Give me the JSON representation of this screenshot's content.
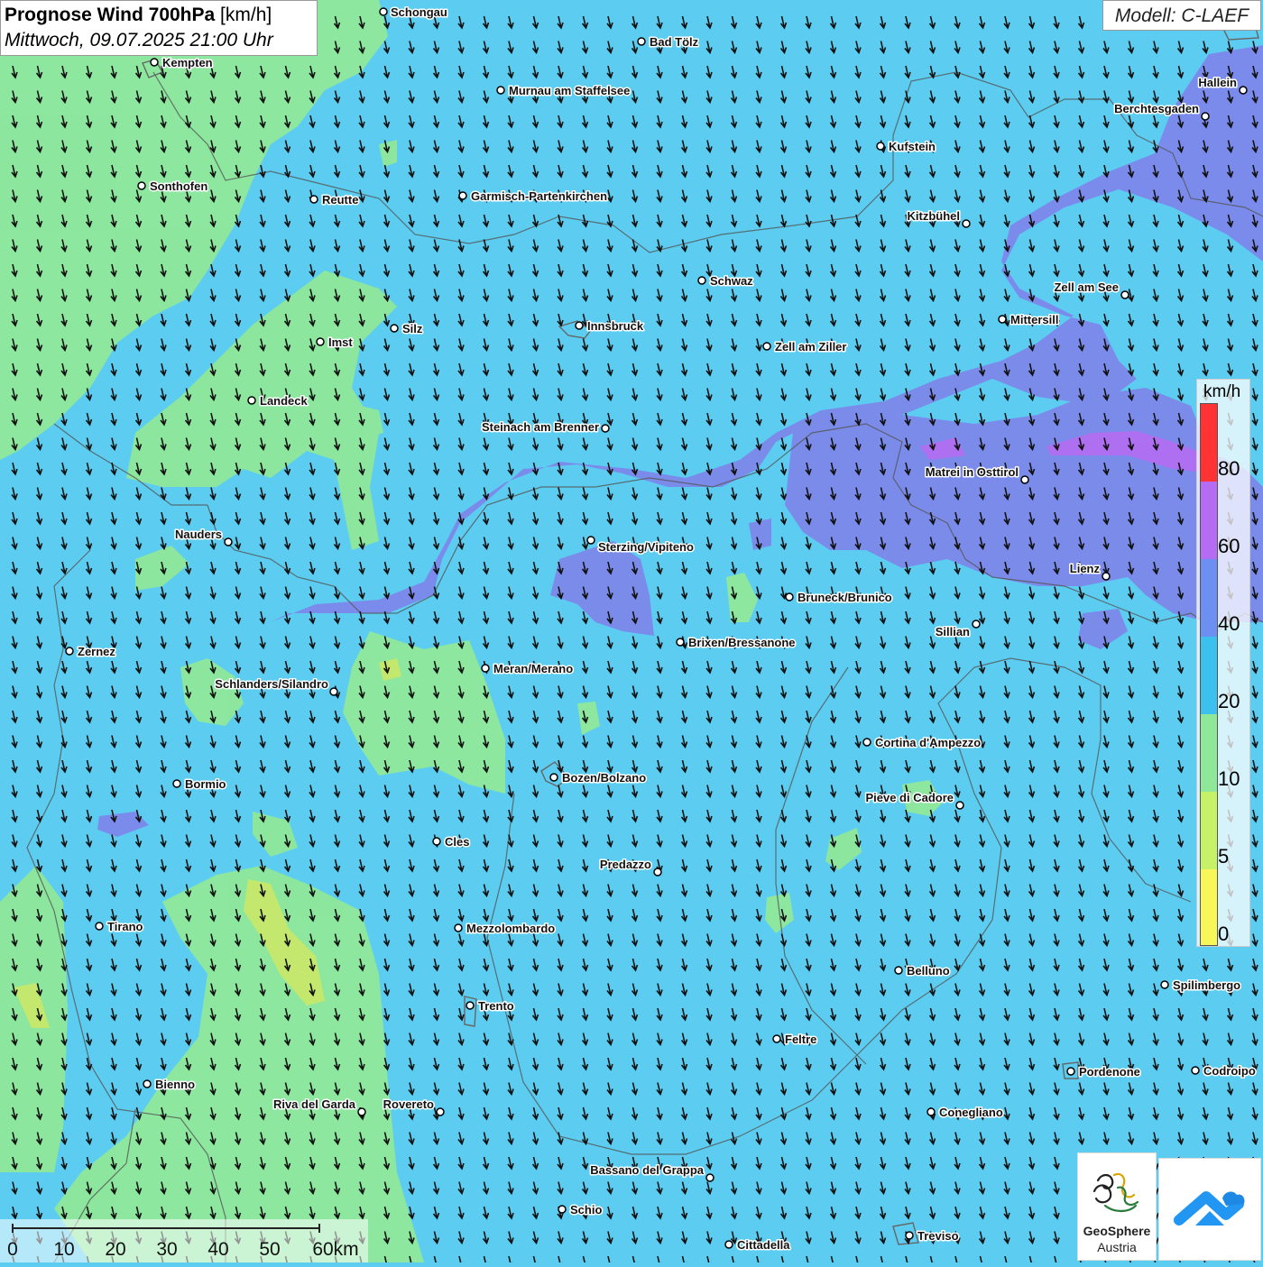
{
  "title": {
    "main_bold": "Prognose Wind 700hPa",
    "unit": "[km/h]",
    "datetime": "Mittwoch, 09.07.2025 21:00 Uhr"
  },
  "model_label": "Modell: C-LAEF",
  "legend": {
    "unit": "km/h",
    "ticks": [
      "80",
      "60",
      "40",
      "20",
      "10",
      "5",
      "0"
    ],
    "colors": [
      "#ff3333",
      "#b46cf2",
      "#9a6df0",
      "#6e8ff2",
      "#3cc0ee",
      "#8fe89a",
      "#c6f26a",
      "#f7f75a"
    ]
  },
  "scale_bar": {
    "labels": [
      "0",
      "10",
      "20",
      "30",
      "40",
      "50",
      "60km"
    ]
  },
  "cities": [
    {
      "name": "Schongau"
    },
    {
      "name": "Bad Tölz"
    },
    {
      "name": "Kempten"
    },
    {
      "name": "Murnau am Staffelsee"
    },
    {
      "name": "Hallein"
    },
    {
      "name": "Berchtesgaden"
    },
    {
      "name": "Kufstein"
    },
    {
      "name": "Sonthofen"
    },
    {
      "name": "Reutte"
    },
    {
      "name": "Garmisch-Partenkirchen"
    },
    {
      "name": "Kitzbühel"
    },
    {
      "name": "Schwaz"
    },
    {
      "name": "Zell am See"
    },
    {
      "name": "Mittersill"
    },
    {
      "name": "Innsbruck"
    },
    {
      "name": "Silz"
    },
    {
      "name": "Imst"
    },
    {
      "name": "Zell am Ziller"
    },
    {
      "name": "Landeck"
    },
    {
      "name": "Steinach am Brenner"
    },
    {
      "name": "Matrei in Osttirol"
    },
    {
      "name": "Nauders"
    },
    {
      "name": "Sterzing/Vipiteno"
    },
    {
      "name": "Lienz"
    },
    {
      "name": "Bruneck/Brunico"
    },
    {
      "name": "Sillian"
    },
    {
      "name": "Zernez"
    },
    {
      "name": "Brixen/Bressanone"
    },
    {
      "name": "Meran/Merano"
    },
    {
      "name": "Schlanders/Silandro"
    },
    {
      "name": "Cortina d'Ampezzo"
    },
    {
      "name": "Bozen/Bolzano"
    },
    {
      "name": "Bormio"
    },
    {
      "name": "Pieve di Cadore"
    },
    {
      "name": "Cles"
    },
    {
      "name": "Predazzo"
    },
    {
      "name": "Tirano"
    },
    {
      "name": "Mezzolombardo"
    },
    {
      "name": "Belluno"
    },
    {
      "name": "Spilimbergo"
    },
    {
      "name": "Trento"
    },
    {
      "name": "Feltre"
    },
    {
      "name": "Pordenone"
    },
    {
      "name": "Codroipo"
    },
    {
      "name": "Bienno"
    },
    {
      "name": "Riva del Garda"
    },
    {
      "name": "Rovereto"
    },
    {
      "name": "Conegliano"
    },
    {
      "name": "Bassano del Grappa"
    },
    {
      "name": "Schio"
    },
    {
      "name": "Treviso"
    },
    {
      "name": "Cittadella"
    }
  ],
  "logos": {
    "geosphere": "GeoSphere\nAustria",
    "geosphere_line1": "GeoSphere",
    "geosphere_line2": "Austria"
  },
  "colors": {
    "background": "#5ccdf1",
    "light_green": "#8fe89a",
    "blue_purple": "#7e86ea",
    "purple": "#9a6df0",
    "yellow_green": "#c6e86a"
  }
}
